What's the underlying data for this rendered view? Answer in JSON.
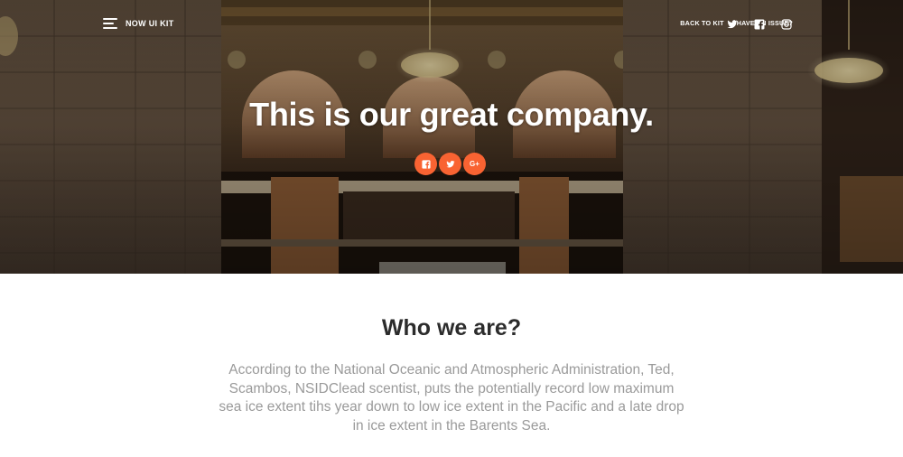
{
  "navbar": {
    "brand": "NOW UI KIT",
    "links": [
      "BACK TO KIT",
      "HAVE AN ISSUE?"
    ],
    "social_icons": [
      "twitter-icon",
      "facebook-icon",
      "instagram-icon"
    ]
  },
  "hero": {
    "title": "This is our great company.",
    "share_buttons": [
      "facebook-icon",
      "twitter-icon",
      "google-plus-icon"
    ],
    "share_gplus_label": "G+",
    "accent_color": "#f96332"
  },
  "about": {
    "title": "Who we are?",
    "text": "According to the National Oceanic and Atmospheric Administration, Ted, Scambos, NSIDClead scentist, puts the potentially record low maximum sea ice extent tihs year down to low ice extent in the Pacific and a late drop in ice extent in the Barents Sea."
  }
}
